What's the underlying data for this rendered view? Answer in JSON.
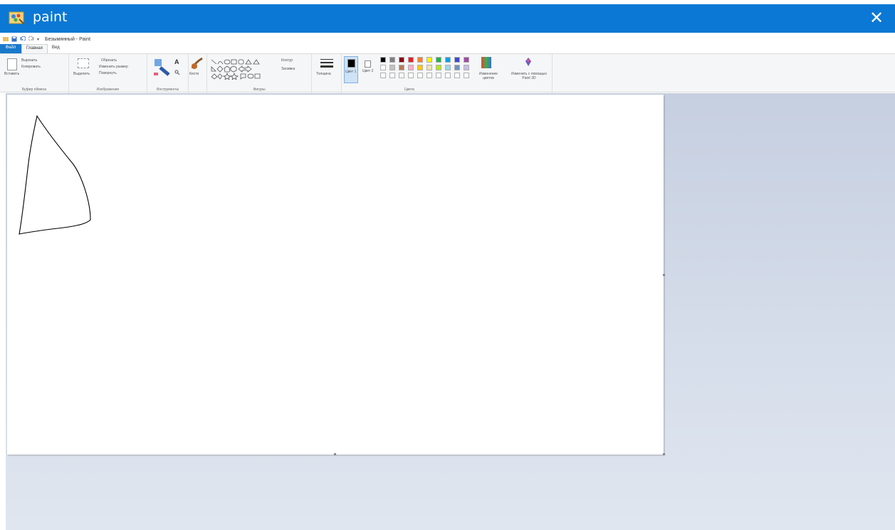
{
  "window": {
    "title": "paint",
    "close_label": "✕"
  },
  "qat": {
    "doc_title": "Безымянный - Paint"
  },
  "tabs": [
    {
      "label": "Файл"
    },
    {
      "label": "Главная"
    },
    {
      "label": "Вид"
    }
  ],
  "ribbon": {
    "clipboard": {
      "paste_label": "Вставить",
      "cut_label": "Вырезать",
      "copy_label": "Копировать",
      "group_label": "Буфер обмена"
    },
    "image": {
      "select_label": "Выделить",
      "crop_label": "Обрезать",
      "resize_label": "Изменить размер",
      "rotate_label": "Повернуть",
      "group_label": "Изображение"
    },
    "tools": {
      "group_label": "Инструменты"
    },
    "brushes": {
      "label": "Кисти"
    },
    "shapes": {
      "outline_label": "Контур",
      "fill_label": "Заливка",
      "group_label": "Фигуры"
    },
    "size": {
      "label": "Толщина"
    },
    "colors": {
      "color1_label": "Цвет 1",
      "color2_label": "Цвет 2",
      "edit_label": "Изменение цветов",
      "paint3d_label": "Изменить с помощью Paint 3D",
      "group_label": "Цвета",
      "color1": "#000000",
      "color2": "#ffffff",
      "palette_row1": [
        "#000000",
        "#7f7f7f",
        "#880015",
        "#ed1c24",
        "#ff7f27",
        "#fff200",
        "#22b14c",
        "#00a2e8",
        "#3f48cc",
        "#a349a4"
      ],
      "palette_row2": [
        "#ffffff",
        "#c3c3c3",
        "#b97a57",
        "#ffaec9",
        "#ffc90e",
        "#efe4b0",
        "#b5e61d",
        "#99d9ea",
        "#7092be",
        "#c8bfe7"
      ]
    }
  },
  "canvas": {
    "background": "#ffffff"
  }
}
